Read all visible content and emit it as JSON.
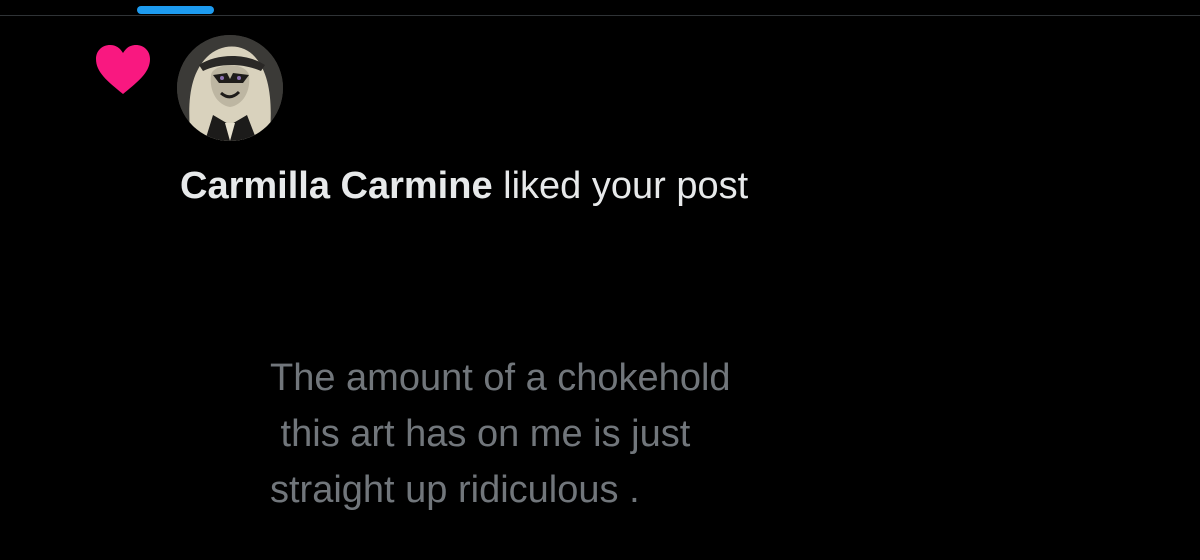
{
  "header": {
    "active_tab_indicator_color": "#1d9bf0"
  },
  "notification": {
    "type_icon": "heart-icon",
    "like_color": "#f91880",
    "avatar_icon": "user-avatar",
    "username": "Carmilla Carmine",
    "action_text": " liked your post",
    "post_preview_lines": [
      "The amount of a chokehold",
      " this art has on me is just",
      "straight up ridiculous ."
    ]
  },
  "colors": {
    "background": "#000000",
    "primary_text": "#e7e9ea",
    "secondary_text": "#71767b"
  }
}
